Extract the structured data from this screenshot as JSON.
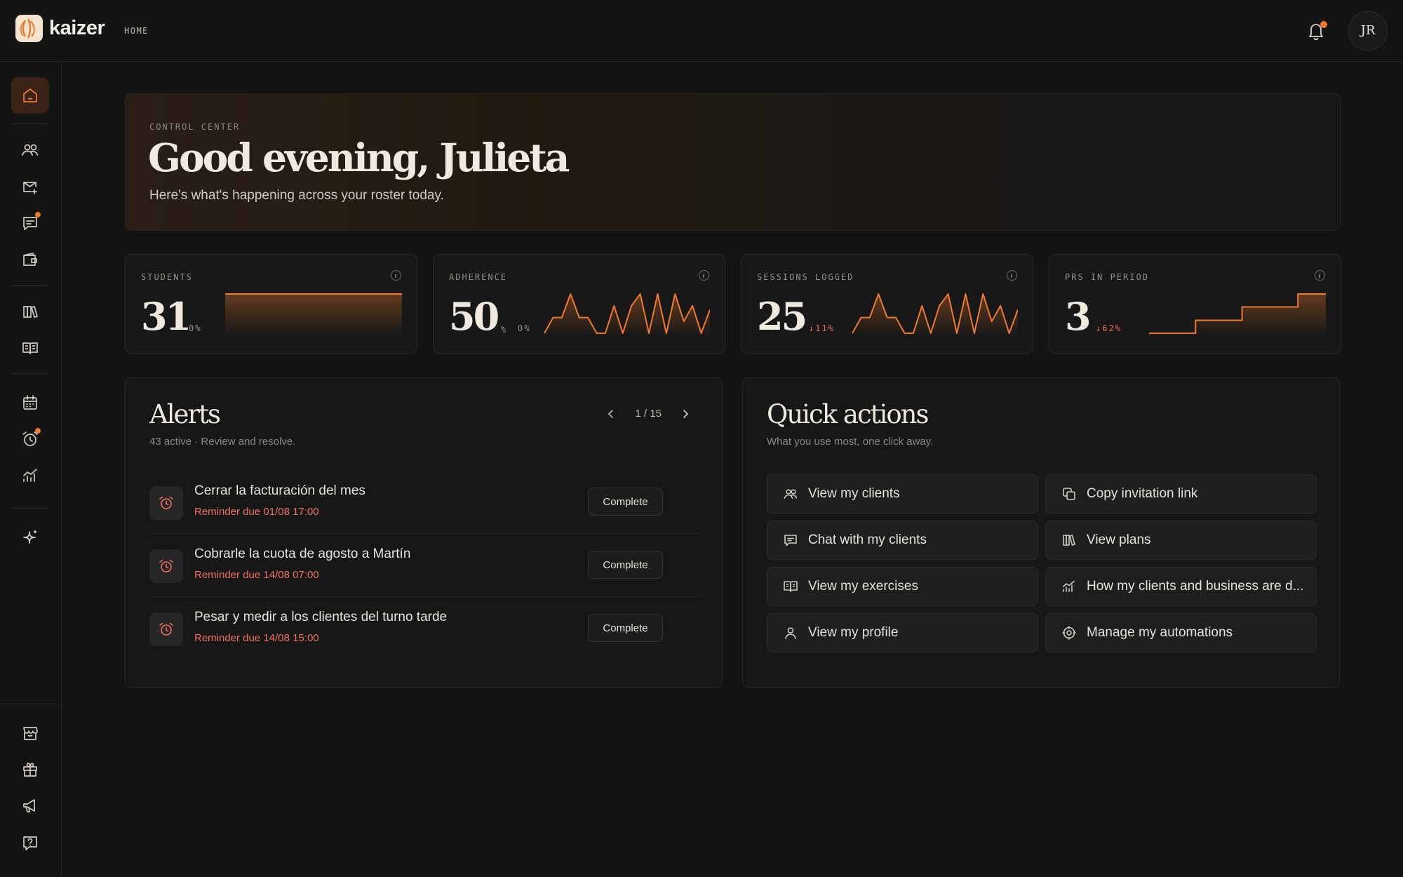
{
  "app": {
    "name": "kaizer",
    "breadcrumb": "HOME",
    "avatar_initials": "JR",
    "accent": "#f07a2c",
    "alert_color": "#f07060"
  },
  "hero": {
    "kicker": "CONTROL CENTER",
    "title": "Good evening, Julieta",
    "subtitle": "Here's what's happening across your roster today."
  },
  "stats": [
    {
      "label": "STUDENTS",
      "value": "31",
      "unit": "",
      "delta": "0%",
      "delta_dir": "neutral",
      "trend": [
        1,
        1,
        1,
        1,
        1,
        1,
        1,
        1,
        1,
        1,
        1,
        1,
        1,
        1,
        1,
        1,
        1,
        1,
        1,
        1
      ]
    },
    {
      "label": "ADHERENCE",
      "value": "50",
      "unit": "%",
      "delta": "0%",
      "delta_dir": "neutral",
      "trend": [
        0,
        0.4,
        0.4,
        1,
        0.4,
        0.4,
        0,
        0,
        0.7,
        0,
        0.7,
        1,
        0,
        1,
        0,
        1,
        0.3,
        0.7,
        0,
        0.6
      ]
    },
    {
      "label": "SESSIONS LOGGED",
      "value": "25",
      "unit": "",
      "delta": "↓11%",
      "delta_dir": "down",
      "trend": [
        0,
        0.4,
        0.4,
        1,
        0.4,
        0.4,
        0,
        0,
        0.7,
        0,
        0.7,
        1,
        0,
        1,
        0,
        1,
        0.3,
        0.7,
        0,
        0.6
      ]
    },
    {
      "label": "PRS IN PERIOD",
      "value": "3",
      "unit": "",
      "delta": "↓62%",
      "delta_dir": "down",
      "trend": [
        0,
        0,
        0,
        0,
        0,
        0.33,
        0.33,
        0.33,
        0.33,
        0.33,
        0.67,
        0.67,
        0.67,
        0.67,
        0.67,
        0.67,
        1,
        1,
        1,
        1
      ]
    }
  ],
  "alerts": {
    "title": "Alerts",
    "subtitle": "43 active · Review and resolve.",
    "pager": "1 / 15",
    "items": [
      {
        "title": "Cerrar la facturación del mes",
        "due": "Reminder due 01/08 17:00",
        "action": "Complete"
      },
      {
        "title": "Cobrarle la cuota de agosto a Martín",
        "due": "Reminder due 14/08 07:00",
        "action": "Complete"
      },
      {
        "title": "Pesar y medir a los clientes del turno tarde",
        "due": "Reminder due 14/08 15:00",
        "action": "Complete"
      }
    ]
  },
  "quick_actions": {
    "title": "Quick actions",
    "subtitle": "What you use most, one click away.",
    "items": [
      {
        "label": "View my clients",
        "icon": "users-icon"
      },
      {
        "label": "Copy invitation link",
        "icon": "copy-icon"
      },
      {
        "label": "Chat with my clients",
        "icon": "chat-icon"
      },
      {
        "label": "View plans",
        "icon": "books-icon"
      },
      {
        "label": "View my exercises",
        "icon": "book-open-icon"
      },
      {
        "label": "How my clients and business are d...",
        "icon": "chart-icon"
      },
      {
        "label": "View my profile",
        "icon": "user-icon"
      },
      {
        "label": "Manage my automations",
        "icon": "automation-icon"
      }
    ]
  }
}
